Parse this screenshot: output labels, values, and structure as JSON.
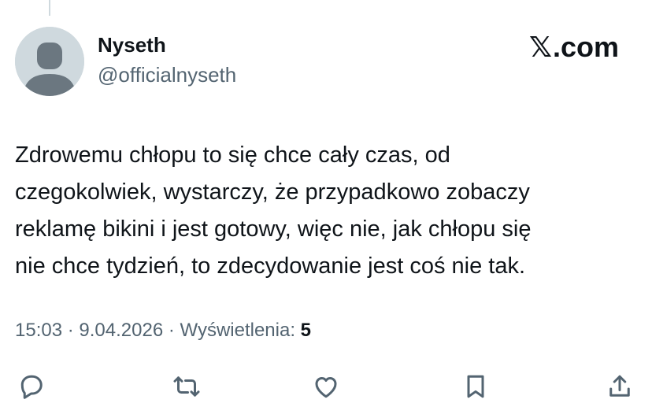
{
  "author": {
    "display_name": "Nyseth",
    "handle": "@officialnyseth"
  },
  "brand": {
    "logo": "𝕏",
    "domain": ".com"
  },
  "tweet": {
    "text": "Zdrowemu chłopu to się chce cały czas, od\nczegokolwiek, wystarczy, że przypadkowo zobaczy\nreklamę bikini i jest gotowy, więc nie, jak chłopu się\nnie chce tydzień, to zdecydowanie jest coś nie tak."
  },
  "meta": {
    "time": "15:03",
    "sep1": " · ",
    "date": "9.04.2026",
    "sep2": " · ",
    "views_label": "Wyświetlenia: ",
    "views_count": "5"
  },
  "actions": {
    "icons": [
      "reply-icon",
      "retweet-icon",
      "like-icon",
      "bookmark-icon",
      "share-icon"
    ]
  },
  "colors": {
    "text_primary": "#0f1419",
    "text_secondary": "#536471",
    "avatar_bg": "#cfd9de",
    "avatar_fg": "#6b7780"
  }
}
